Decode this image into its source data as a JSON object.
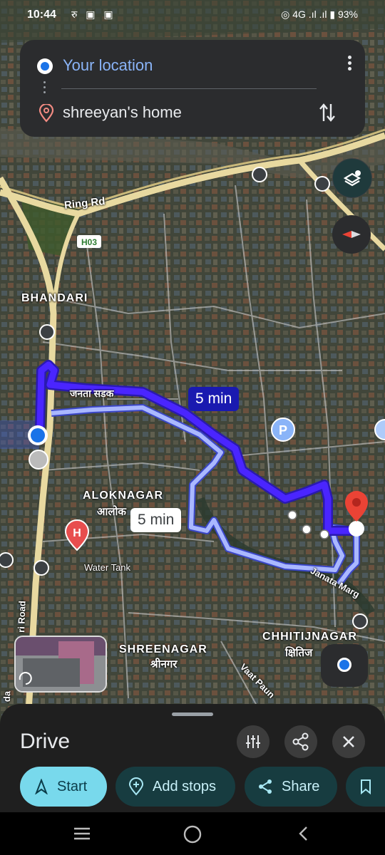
{
  "status_bar": {
    "time": "10:44",
    "left_icons": "रु ▣ ▣",
    "right_icons": "◎ 4G .ıl .ıl ▮",
    "battery": "93%"
  },
  "search": {
    "origin": "Your location",
    "destination": "shreeyan's home"
  },
  "map": {
    "labels": {
      "ring_rd": "Ring Rd",
      "h03": "H03",
      "bhandari": "BHANDARI",
      "janata_sadak": "जनता सडक",
      "aloknagar": "ALOKNAGAR",
      "aloknagar_np": "आलोक",
      "water_tank": "Water Tank",
      "janata_marg": "Janata Marg",
      "chhitijnagar": "CHHITIJNAGAR",
      "chhitij_np": "क्षितिज",
      "shreenagar": "SHREENAGAR",
      "shreenagar_np": "श्रीनगर",
      "vaat_paun": "Vaat Paun",
      "ri_road": "ri Road",
      "da": "da",
      "parking": "P",
      "hospital": "H"
    },
    "eta_primary": "5 min",
    "eta_alternate": "5 min",
    "colors": {
      "route_primary": "#3b1ee8",
      "route_alt": "#aab8ff",
      "my_location": "#1a73e8",
      "destination_pin": "#ea4335"
    }
  },
  "sheet": {
    "mode_title": "Drive",
    "buttons": {
      "start": "Start",
      "add_stops": "Add stops",
      "share": "Share"
    },
    "icons": [
      "route-options-icon",
      "share-icon",
      "close-icon",
      "bookmark-icon"
    ]
  },
  "nav": {
    "icons": [
      "recents-icon",
      "home-icon",
      "back-icon"
    ]
  }
}
